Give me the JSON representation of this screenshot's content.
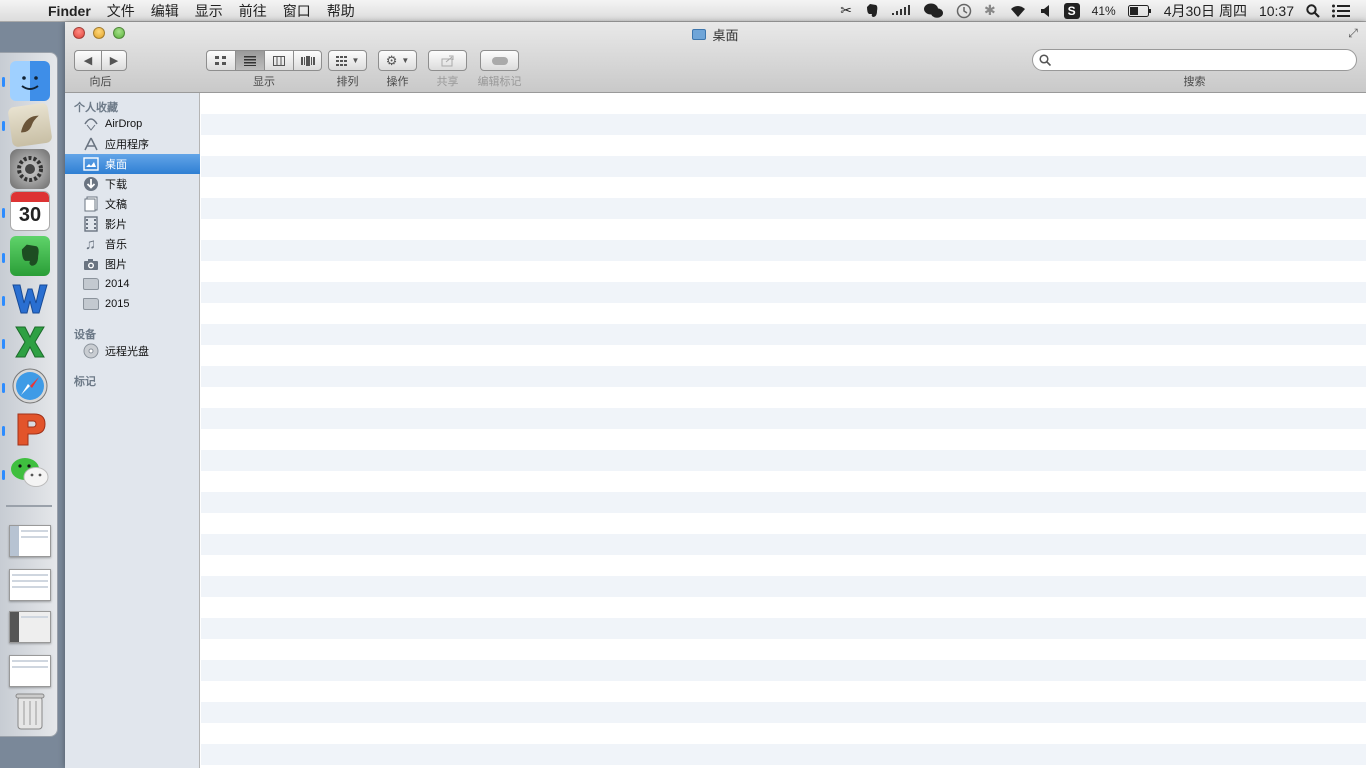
{
  "menubar": {
    "app_name": "Finder",
    "menus": [
      "文件",
      "编辑",
      "显示",
      "前往",
      "窗口",
      "帮助"
    ],
    "battery_percent": "41%",
    "date": "4月30日 周四",
    "time": "10:37"
  },
  "window": {
    "title": "桌面",
    "toolbar": {
      "back_label": "向后",
      "view_label": "显示",
      "arrange_label": "排列",
      "action_label": "操作",
      "share_label": "共享",
      "tags_label": "编辑标记",
      "search_label": "搜索",
      "search_placeholder": ""
    }
  },
  "sidebar": {
    "favorites_header": "个人收藏",
    "favorites": [
      {
        "label": "AirDrop",
        "icon": "airdrop-icon"
      },
      {
        "label": "应用程序",
        "icon": "applications-icon"
      },
      {
        "label": "桌面",
        "icon": "desktop-icon",
        "selected": true
      },
      {
        "label": "下载",
        "icon": "downloads-icon"
      },
      {
        "label": "文稿",
        "icon": "documents-icon"
      },
      {
        "label": "影片",
        "icon": "movies-icon"
      },
      {
        "label": "音乐",
        "icon": "music-icon"
      },
      {
        "label": "图片",
        "icon": "pictures-icon"
      },
      {
        "label": "2014",
        "icon": "folder-icon"
      },
      {
        "label": "2015",
        "icon": "folder-icon"
      }
    ],
    "devices_header": "设备",
    "devices": [
      {
        "label": "远程光盘",
        "icon": "disc-icon"
      }
    ],
    "tags_header": "标记"
  },
  "dock": {
    "calendar_day": "30",
    "apps": [
      "finder-icon",
      "mail-icon",
      "system-preferences-icon",
      "calendar-icon",
      "evernote-icon",
      "word-icon",
      "excel-icon",
      "safari-icon",
      "powerpoint-icon",
      "wechat-icon"
    ]
  },
  "colors": {
    "selection": "#3a87da",
    "sidebar_bg": "#e1e6ed",
    "row_alt": "#f0f4f9"
  }
}
